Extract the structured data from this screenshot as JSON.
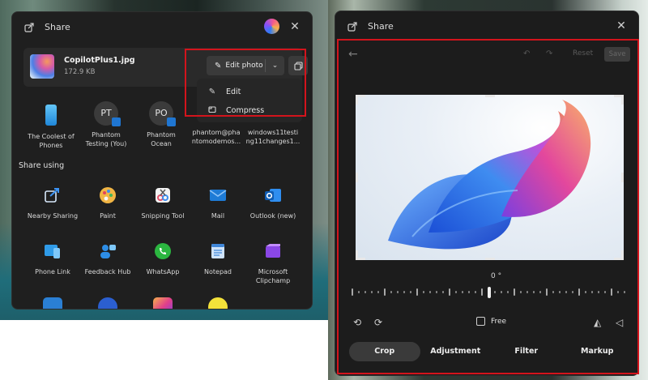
{
  "left_window": {
    "title": "Share",
    "file": {
      "name": "CopilotPlus1.jpg",
      "size": "172.9 KB"
    },
    "edit_button_label": "Edit photo",
    "dropdown_items": [
      {
        "label": "Edit",
        "icon": "pencil-icon"
      },
      {
        "label": "Compress",
        "icon": "compress-icon"
      }
    ],
    "contacts": [
      {
        "initials": "",
        "line1": "The Coolest of",
        "line2": "Phones",
        "icon": "phone-device-icon"
      },
      {
        "initials": "PT",
        "line1": "Phantom",
        "line2": "Testing (You)"
      },
      {
        "initials": "PO",
        "line1": "Phantom",
        "line2": "Ocean"
      },
      {
        "initials": "",
        "line1": "phantom@pha",
        "line2": "ntomodemos..."
      },
      {
        "initials": "",
        "line1": "windows11testi",
        "line2": "ng11changes1..."
      }
    ],
    "share_using_label": "Share using",
    "apps": [
      {
        "line1": "Nearby Sharing",
        "line2": "",
        "icon": "nearby-sharing-icon",
        "color": "#2f8ef0"
      },
      {
        "line1": "Paint",
        "line2": "",
        "icon": "paint-icon",
        "color": "#f0a42c"
      },
      {
        "line1": "Snipping Tool",
        "line2": "",
        "icon": "snipping-tool-icon",
        "color": "#e4506a"
      },
      {
        "line1": "Mail",
        "line2": "",
        "icon": "mail-icon",
        "color": "#1e7bd6"
      },
      {
        "line1": "Outlook (new)",
        "line2": "",
        "icon": "outlook-icon",
        "color": "#0f6cc7"
      },
      {
        "line1": "Phone Link",
        "line2": "",
        "icon": "phone-link-icon",
        "color": "#2f9be8"
      },
      {
        "line1": "Feedback Hub",
        "line2": "",
        "icon": "feedback-hub-icon",
        "color": "#2d8de6"
      },
      {
        "line1": "WhatsApp",
        "line2": "",
        "icon": "whatsapp-icon",
        "color": "#2bb640"
      },
      {
        "line1": "Notepad",
        "line2": "",
        "icon": "notepad-icon",
        "color": "#3f86d8"
      },
      {
        "line1": "Microsoft",
        "line2": "Clipchamp",
        "icon": "clipchamp-icon",
        "color": "#8a47e6"
      }
    ]
  },
  "right_window": {
    "title": "Share",
    "reset_label": "Reset",
    "save_label": "Save",
    "angle_readout": "0 °",
    "aspect_label": "Free",
    "tabs": [
      {
        "label": "Crop",
        "active": true
      },
      {
        "label": "Adjustment",
        "active": false
      },
      {
        "label": "Filter",
        "active": false
      },
      {
        "label": "Markup",
        "active": false
      }
    ]
  },
  "highlight_color": "#d3141c"
}
